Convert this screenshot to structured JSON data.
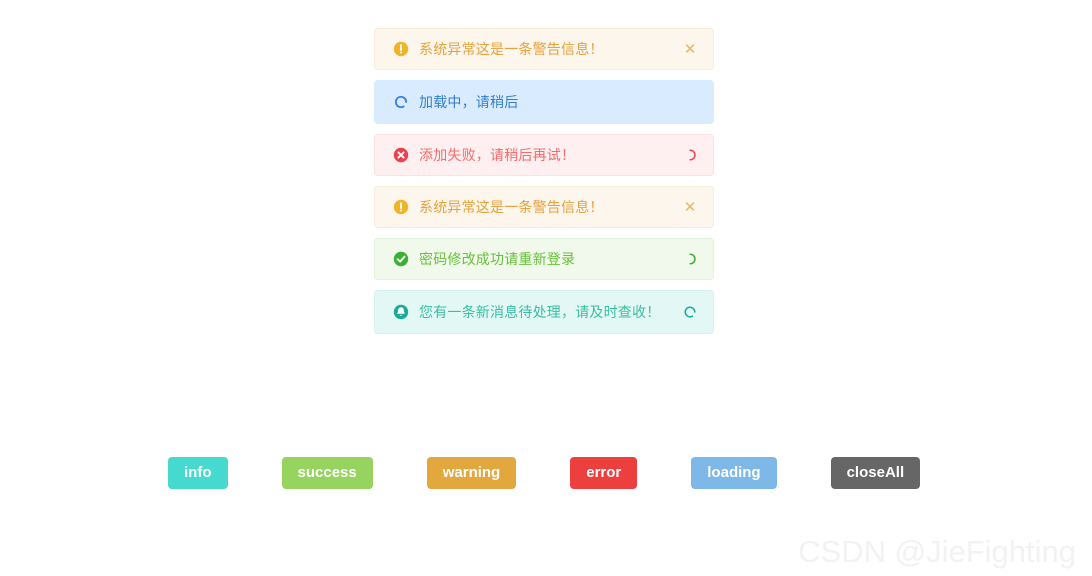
{
  "page": {
    "background": "#ffffff",
    "watermark": "CSDN @JieFighting"
  },
  "alerts": [
    {
      "type": "warning",
      "icon": "warning-circle-icon",
      "icon_color": "#f0b429",
      "message": "系统异常这是一条警告信息！",
      "right_icon": "close-icon",
      "right_glyph": "✕"
    },
    {
      "type": "loading",
      "icon": "loading-spinner-icon",
      "icon_color": "#3f82e8",
      "message": "加载中，请稍后",
      "right_icon": "none",
      "right_glyph": ""
    },
    {
      "type": "error",
      "icon": "error-circle-icon",
      "icon_color": "#ee3f4d",
      "message": "添加失败，请稍后再试！",
      "right_icon": "loading-spinner-icon",
      "right_glyph": ""
    },
    {
      "type": "warning",
      "icon": "warning-circle-icon",
      "icon_color": "#f0b429",
      "message": "系统异常这是一条警告信息！",
      "right_icon": "close-icon",
      "right_glyph": "✕"
    },
    {
      "type": "success",
      "icon": "success-check-icon",
      "icon_color": "#3cb034",
      "message": "密码修改成功请重新登录",
      "right_icon": "loading-spinner-icon",
      "right_glyph": ""
    },
    {
      "type": "info",
      "icon": "bell-icon",
      "icon_color": "#1aab97",
      "message": "您有一条新消息待处理，请及时查收！",
      "right_icon": "loading-spinner-icon",
      "right_glyph": ""
    }
  ],
  "buttons": [
    {
      "label": "info",
      "color": "#45d9d0"
    },
    {
      "label": "success",
      "color": "#96d35f"
    },
    {
      "label": "warning",
      "color": "#e2a83e"
    },
    {
      "label": "error",
      "color": "#ee3f3f"
    },
    {
      "label": "loading",
      "color": "#7eb8e8"
    },
    {
      "label": "closeAll",
      "color": "#666666"
    }
  ]
}
